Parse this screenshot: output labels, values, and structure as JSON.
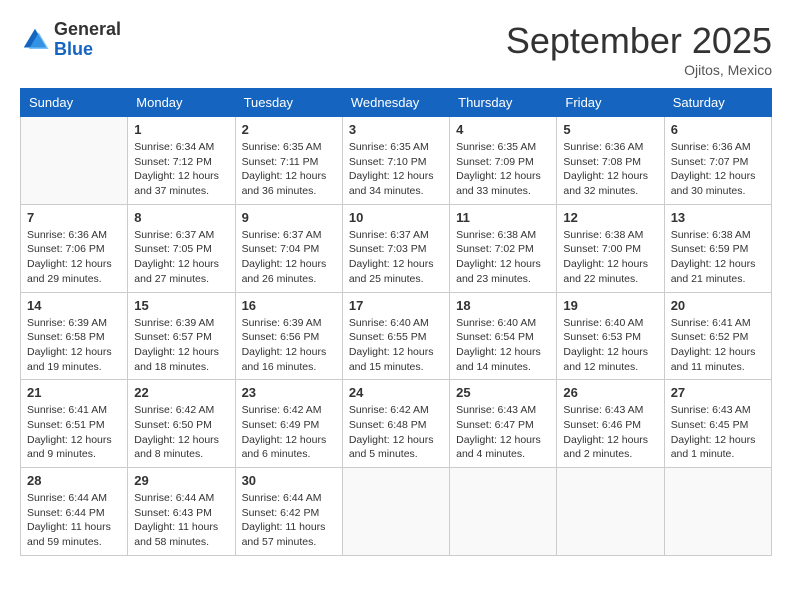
{
  "header": {
    "logo_general": "General",
    "logo_blue": "Blue",
    "month_title": "September 2025",
    "location": "Ojitos, Mexico"
  },
  "weekdays": [
    "Sunday",
    "Monday",
    "Tuesday",
    "Wednesday",
    "Thursday",
    "Friday",
    "Saturday"
  ],
  "weeks": [
    [
      {
        "day": "",
        "info": ""
      },
      {
        "day": "1",
        "info": "Sunrise: 6:34 AM\nSunset: 7:12 PM\nDaylight: 12 hours and 37 minutes."
      },
      {
        "day": "2",
        "info": "Sunrise: 6:35 AM\nSunset: 7:11 PM\nDaylight: 12 hours and 36 minutes."
      },
      {
        "day": "3",
        "info": "Sunrise: 6:35 AM\nSunset: 7:10 PM\nDaylight: 12 hours and 34 minutes."
      },
      {
        "day": "4",
        "info": "Sunrise: 6:35 AM\nSunset: 7:09 PM\nDaylight: 12 hours and 33 minutes."
      },
      {
        "day": "5",
        "info": "Sunrise: 6:36 AM\nSunset: 7:08 PM\nDaylight: 12 hours and 32 minutes."
      },
      {
        "day": "6",
        "info": "Sunrise: 6:36 AM\nSunset: 7:07 PM\nDaylight: 12 hours and 30 minutes."
      }
    ],
    [
      {
        "day": "7",
        "info": "Sunrise: 6:36 AM\nSunset: 7:06 PM\nDaylight: 12 hours and 29 minutes."
      },
      {
        "day": "8",
        "info": "Sunrise: 6:37 AM\nSunset: 7:05 PM\nDaylight: 12 hours and 27 minutes."
      },
      {
        "day": "9",
        "info": "Sunrise: 6:37 AM\nSunset: 7:04 PM\nDaylight: 12 hours and 26 minutes."
      },
      {
        "day": "10",
        "info": "Sunrise: 6:37 AM\nSunset: 7:03 PM\nDaylight: 12 hours and 25 minutes."
      },
      {
        "day": "11",
        "info": "Sunrise: 6:38 AM\nSunset: 7:02 PM\nDaylight: 12 hours and 23 minutes."
      },
      {
        "day": "12",
        "info": "Sunrise: 6:38 AM\nSunset: 7:00 PM\nDaylight: 12 hours and 22 minutes."
      },
      {
        "day": "13",
        "info": "Sunrise: 6:38 AM\nSunset: 6:59 PM\nDaylight: 12 hours and 21 minutes."
      }
    ],
    [
      {
        "day": "14",
        "info": "Sunrise: 6:39 AM\nSunset: 6:58 PM\nDaylight: 12 hours and 19 minutes."
      },
      {
        "day": "15",
        "info": "Sunrise: 6:39 AM\nSunset: 6:57 PM\nDaylight: 12 hours and 18 minutes."
      },
      {
        "day": "16",
        "info": "Sunrise: 6:39 AM\nSunset: 6:56 PM\nDaylight: 12 hours and 16 minutes."
      },
      {
        "day": "17",
        "info": "Sunrise: 6:40 AM\nSunset: 6:55 PM\nDaylight: 12 hours and 15 minutes."
      },
      {
        "day": "18",
        "info": "Sunrise: 6:40 AM\nSunset: 6:54 PM\nDaylight: 12 hours and 14 minutes."
      },
      {
        "day": "19",
        "info": "Sunrise: 6:40 AM\nSunset: 6:53 PM\nDaylight: 12 hours and 12 minutes."
      },
      {
        "day": "20",
        "info": "Sunrise: 6:41 AM\nSunset: 6:52 PM\nDaylight: 12 hours and 11 minutes."
      }
    ],
    [
      {
        "day": "21",
        "info": "Sunrise: 6:41 AM\nSunset: 6:51 PM\nDaylight: 12 hours and 9 minutes."
      },
      {
        "day": "22",
        "info": "Sunrise: 6:42 AM\nSunset: 6:50 PM\nDaylight: 12 hours and 8 minutes."
      },
      {
        "day": "23",
        "info": "Sunrise: 6:42 AM\nSunset: 6:49 PM\nDaylight: 12 hours and 6 minutes."
      },
      {
        "day": "24",
        "info": "Sunrise: 6:42 AM\nSunset: 6:48 PM\nDaylight: 12 hours and 5 minutes."
      },
      {
        "day": "25",
        "info": "Sunrise: 6:43 AM\nSunset: 6:47 PM\nDaylight: 12 hours and 4 minutes."
      },
      {
        "day": "26",
        "info": "Sunrise: 6:43 AM\nSunset: 6:46 PM\nDaylight: 12 hours and 2 minutes."
      },
      {
        "day": "27",
        "info": "Sunrise: 6:43 AM\nSunset: 6:45 PM\nDaylight: 12 hours and 1 minute."
      }
    ],
    [
      {
        "day": "28",
        "info": "Sunrise: 6:44 AM\nSunset: 6:44 PM\nDaylight: 11 hours and 59 minutes."
      },
      {
        "day": "29",
        "info": "Sunrise: 6:44 AM\nSunset: 6:43 PM\nDaylight: 11 hours and 58 minutes."
      },
      {
        "day": "30",
        "info": "Sunrise: 6:44 AM\nSunset: 6:42 PM\nDaylight: 11 hours and 57 minutes."
      },
      {
        "day": "",
        "info": ""
      },
      {
        "day": "",
        "info": ""
      },
      {
        "day": "",
        "info": ""
      },
      {
        "day": "",
        "info": ""
      }
    ]
  ]
}
